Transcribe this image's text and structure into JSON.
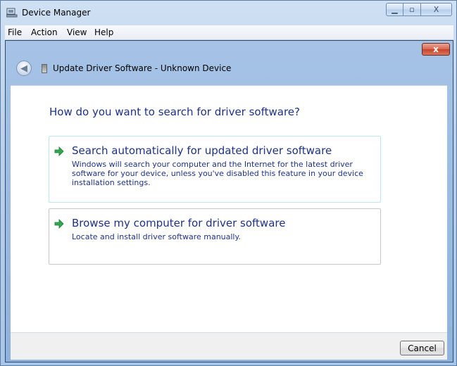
{
  "window": {
    "title": "Device Manager"
  },
  "menubar": {
    "items": [
      "File",
      "Action",
      "View",
      "Help"
    ]
  },
  "dialog": {
    "title": "Update Driver Software - Unknown Device",
    "heading": "How do you want to search for driver software?",
    "options": [
      {
        "title": "Search automatically for updated driver software",
        "description": "Windows will search your computer and the Internet for the latest driver software for your device, unless you've disabled this feature in your device installation settings."
      },
      {
        "title": "Browse my computer for driver software",
        "description": "Locate and install driver software manually."
      }
    ],
    "cancel_label": "Cancel"
  },
  "colors": {
    "link_blue": "#1e3287",
    "arrow_green": "#2fa84f",
    "close_red": "#c5432a"
  }
}
